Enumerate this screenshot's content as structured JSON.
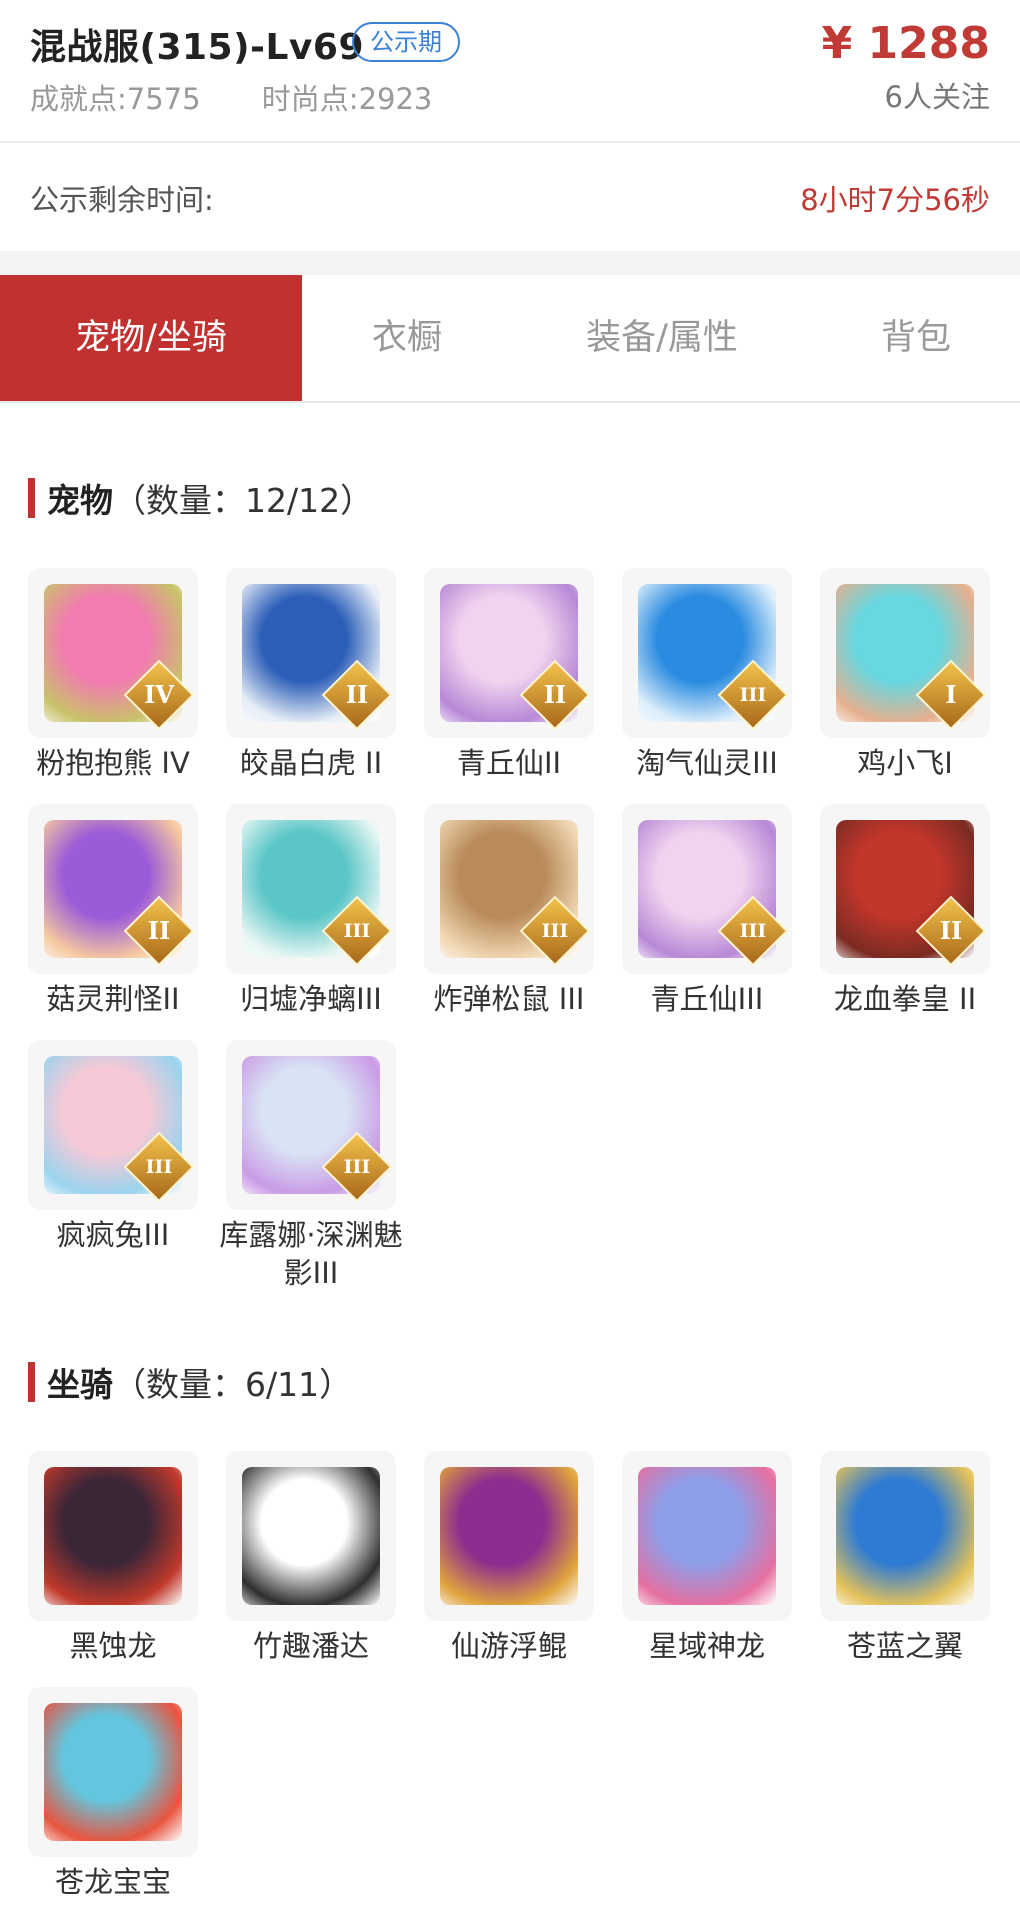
{
  "header": {
    "title": "混战服(315)-Lv69",
    "badge": "公示期",
    "achievement": "成就点:7575",
    "fashion": "时尚点:2923",
    "price": "¥ 1288",
    "follows": "6人关注"
  },
  "countdown": {
    "label": "公示剩余时间:",
    "value": "8小时7分56秒"
  },
  "tabs": [
    "宠物/坐骑",
    "衣橱",
    "装备/属性",
    "背包"
  ],
  "pets": {
    "title": "宠物",
    "count": "（数量：12/12）",
    "items": [
      {
        "name": "粉抱抱熊 IV",
        "rank": "IV",
        "colors": [
          "#f27bb1",
          "#c9c26a"
        ]
      },
      {
        "name": "皎晶白虎 II",
        "rank": "II",
        "colors": [
          "#2d5fb8",
          "#e7eef7"
        ]
      },
      {
        "name": "青丘仙II",
        "rank": "II",
        "colors": [
          "#f0d3ef",
          "#b788d6"
        ]
      },
      {
        "name": "淘气仙灵III",
        "rank": "III",
        "colors": [
          "#2a8be0",
          "#dceefb"
        ]
      },
      {
        "name": "鸡小飞I",
        "rank": "I",
        "colors": [
          "#67d7e0",
          "#e6b08f"
        ]
      },
      {
        "name": "菇灵荆怪II",
        "rank": "II",
        "colors": [
          "#9c5bd8",
          "#f5c9a0"
        ]
      },
      {
        "name": "归墟净螭III",
        "rank": "III",
        "colors": [
          "#5bc6c7",
          "#e9f7f4"
        ]
      },
      {
        "name": "炸弹松鼠 III",
        "rank": "III",
        "colors": [
          "#b98b5b",
          "#f0d7b2"
        ]
      },
      {
        "name": "青丘仙III",
        "rank": "III",
        "colors": [
          "#f0d3ef",
          "#b788d6"
        ]
      },
      {
        "name": "龙血拳皇 II",
        "rank": "II",
        "colors": [
          "#c2362b",
          "#7a2b22"
        ]
      },
      {
        "name": "疯疯兔III",
        "rank": "III",
        "colors": [
          "#f7c9d6",
          "#9ad4ef"
        ]
      },
      {
        "name": "库露娜·深渊魅影III",
        "rank": "III",
        "colors": [
          "#d9e3f4",
          "#c99be6"
        ]
      }
    ]
  },
  "mounts": {
    "title": "坐骑",
    "count": "（数量：6/11）",
    "items": [
      {
        "name": "黑蚀龙",
        "colors": [
          "#3b2638",
          "#c0392b"
        ]
      },
      {
        "name": "竹趣潘达",
        "colors": [
          "#ffffff",
          "#2e2e2e"
        ]
      },
      {
        "name": "仙游浮鲲",
        "colors": [
          "#8e2c8f",
          "#e0a33d"
        ]
      },
      {
        "name": "星域神龙",
        "colors": [
          "#8f9ee8",
          "#e66fa0"
        ]
      },
      {
        "name": "苍蓝之翼",
        "colors": [
          "#2f7bd3",
          "#e4c25a"
        ]
      },
      {
        "name": "苍龙宝宝",
        "colors": [
          "#64c6de",
          "#e8543e"
        ]
      }
    ]
  }
}
